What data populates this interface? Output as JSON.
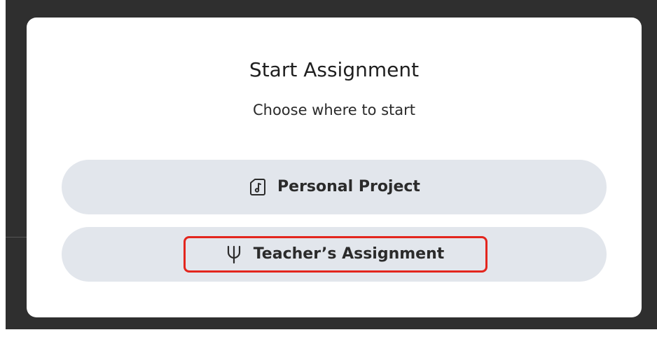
{
  "modal": {
    "title": "Start Assignment",
    "subtitle": "Choose where to start",
    "options": [
      {
        "label": "Personal Project",
        "icon": "music-file-icon"
      },
      {
        "label": "Teacher’s Assignment",
        "icon": "trident-icon"
      }
    ]
  },
  "colors": {
    "backdrop": "#2f2f2f",
    "modal_bg": "#ffffff",
    "option_bg": "#e2e6ec",
    "highlight": "#e3261e"
  }
}
